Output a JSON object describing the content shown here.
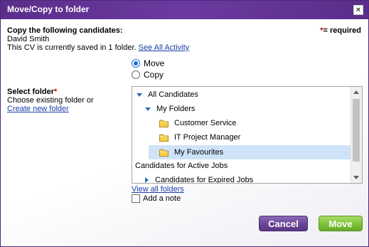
{
  "dialog": {
    "title": "Move/Copy to folder",
    "close_label": "×"
  },
  "header": {
    "copy_label": "Copy the following candidates:",
    "candidate_name": "David Smith",
    "saved_text": "This CV is currently saved in 1 folder.",
    "see_all_activity": "See All Activity",
    "required_marker": "*",
    "required_text": "= required"
  },
  "options": {
    "move_label": "Move",
    "copy_label": "Copy",
    "selected": "Move"
  },
  "folder_select": {
    "label": "Select folder",
    "required_marker": "*",
    "hint": "Choose existing folder or",
    "create_link": "Create new folder",
    "view_all": "View all folders",
    "tree": {
      "all_candidates": "All Candidates",
      "my_folders": "My Folders",
      "customer_service": "Customer Service",
      "it_project_manager": "IT Project Manager",
      "my_favourites": "My Favourites",
      "active_jobs": "Candidates for Active Jobs",
      "expired_jobs": "Candidates for Expired Jobs"
    },
    "selected_folder": "My Favourites"
  },
  "note": {
    "add_note_label": "Add a note",
    "checked": false
  },
  "buttons": {
    "cancel": "Cancel",
    "move": "Move"
  },
  "colors": {
    "title_bar": "#5a2d8a",
    "cancel_button": "#6a4596",
    "move_button": "#7cc238",
    "link": "#1a3ea8",
    "required": "#cc0000",
    "selection": "#cfe3f8"
  },
  "icons": {
    "close": "close-icon",
    "folder": "folder-icon",
    "expanded": "triangle-down-icon",
    "collapsed": "triangle-right-icon"
  }
}
